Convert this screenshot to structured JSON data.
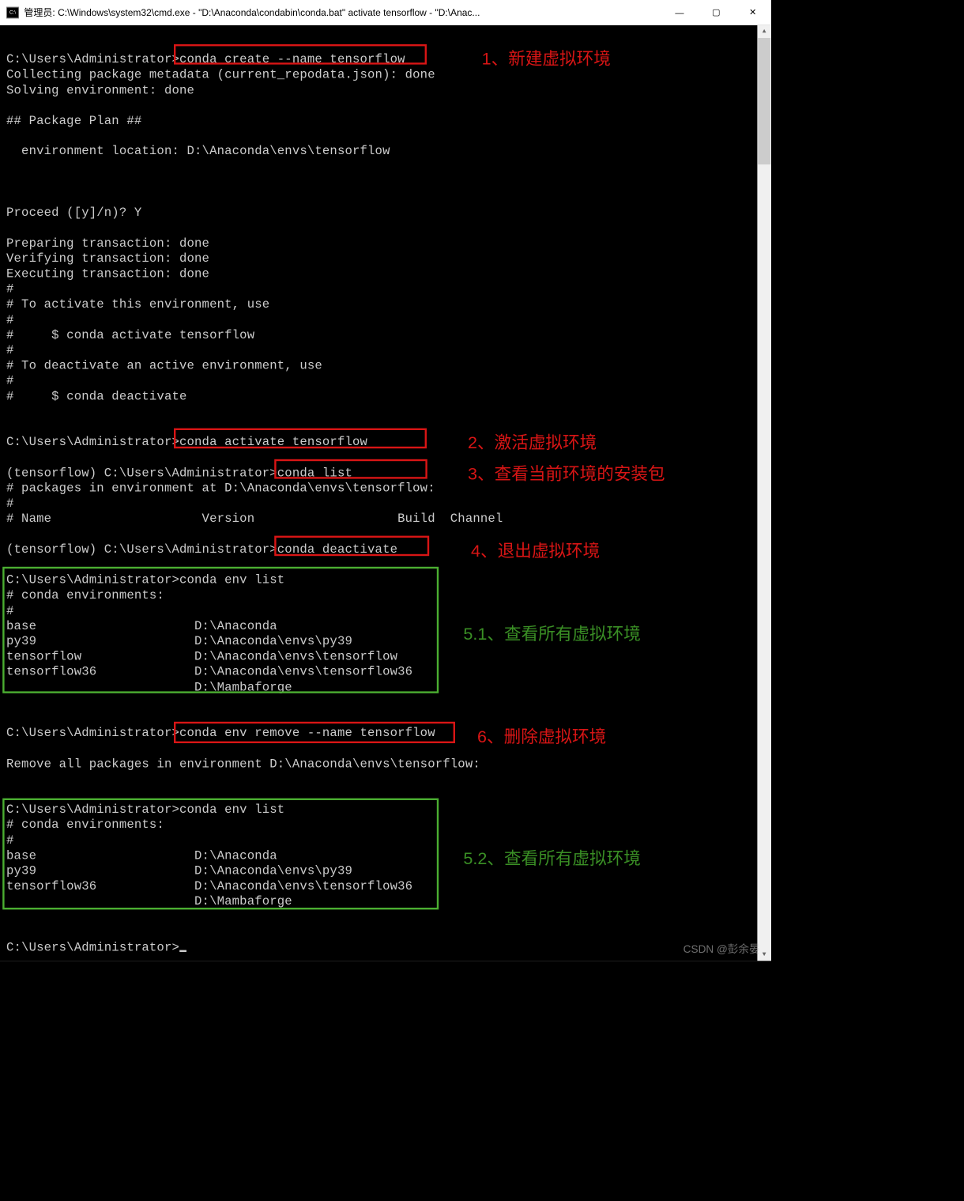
{
  "titlebar": {
    "title": "管理员: C:\\Windows\\system32\\cmd.exe - \"D:\\Anaconda\\condabin\\conda.bat\"  activate tensorflow - \"D:\\Anac..."
  },
  "terminal": {
    "lines": [
      "",
      "C:\\Users\\Administrator>conda create --name tensorflow",
      "Collecting package metadata (current_repodata.json): done",
      "Solving environment: done",
      "",
      "## Package Plan ##",
      "",
      "  environment location: D:\\Anaconda\\envs\\tensorflow",
      "",
      "",
      "",
      "Proceed ([y]/n)? Y",
      "",
      "Preparing transaction: done",
      "Verifying transaction: done",
      "Executing transaction: done",
      "#",
      "# To activate this environment, use",
      "#",
      "#     $ conda activate tensorflow",
      "#",
      "# To deactivate an active environment, use",
      "#",
      "#     $ conda deactivate",
      "",
      "",
      "C:\\Users\\Administrator>conda activate tensorflow",
      "",
      "(tensorflow) C:\\Users\\Administrator>conda list",
      "# packages in environment at D:\\Anaconda\\envs\\tensorflow:",
      "#",
      "# Name                    Version                   Build  Channel",
      "",
      "(tensorflow) C:\\Users\\Administrator>conda deactivate",
      "",
      "C:\\Users\\Administrator>conda env list",
      "# conda environments:",
      "#",
      "base                     D:\\Anaconda",
      "py39                     D:\\Anaconda\\envs\\py39",
      "tensorflow               D:\\Anaconda\\envs\\tensorflow",
      "tensorflow36             D:\\Anaconda\\envs\\tensorflow36",
      "                         D:\\Mambaforge",
      "",
      "",
      "C:\\Users\\Administrator>conda env remove --name tensorflow",
      "",
      "Remove all packages in environment D:\\Anaconda\\envs\\tensorflow:",
      "",
      "",
      "C:\\Users\\Administrator>conda env list",
      "# conda environments:",
      "#",
      "base                     D:\\Anaconda",
      "py39                     D:\\Anaconda\\envs\\py39",
      "tensorflow36             D:\\Anaconda\\envs\\tensorflow36",
      "                         D:\\Mambaforge",
      "",
      "",
      "C:\\Users\\Administrator>"
    ]
  },
  "commands": {
    "create": "conda create --name tensorflow",
    "activate": "conda activate tensorflow",
    "list": "conda list",
    "deactivate": "conda deactivate",
    "envlist": "conda env list",
    "remove": "conda env remove --name tensorflow"
  },
  "env_list_before": [
    {
      "name": "base",
      "path": "D:\\Anaconda"
    },
    {
      "name": "py39",
      "path": "D:\\Anaconda\\envs\\py39"
    },
    {
      "name": "tensorflow",
      "path": "D:\\Anaconda\\envs\\tensorflow"
    },
    {
      "name": "tensorflow36",
      "path": "D:\\Anaconda\\envs\\tensorflow36"
    },
    {
      "name": "",
      "path": "D:\\Mambaforge"
    }
  ],
  "env_list_after": [
    {
      "name": "base",
      "path": "D:\\Anaconda"
    },
    {
      "name": "py39",
      "path": "D:\\Anaconda\\envs\\py39"
    },
    {
      "name": "tensorflow36",
      "path": "D:\\Anaconda\\envs\\tensorflow36"
    },
    {
      "name": "",
      "path": "D:\\Mambaforge"
    }
  ],
  "annotations": {
    "a1": "1、新建虚拟环境",
    "a2": "2、激活虚拟环境",
    "a3": "3、查看当前环境的安装包",
    "a4": "4、退出虚拟环境",
    "a51": "5.1、查看所有虚拟环境",
    "a6": "6、删除虚拟环境",
    "a52": "5.2、查看所有虚拟环境"
  },
  "watermark": "CSDN @彭余晏"
}
